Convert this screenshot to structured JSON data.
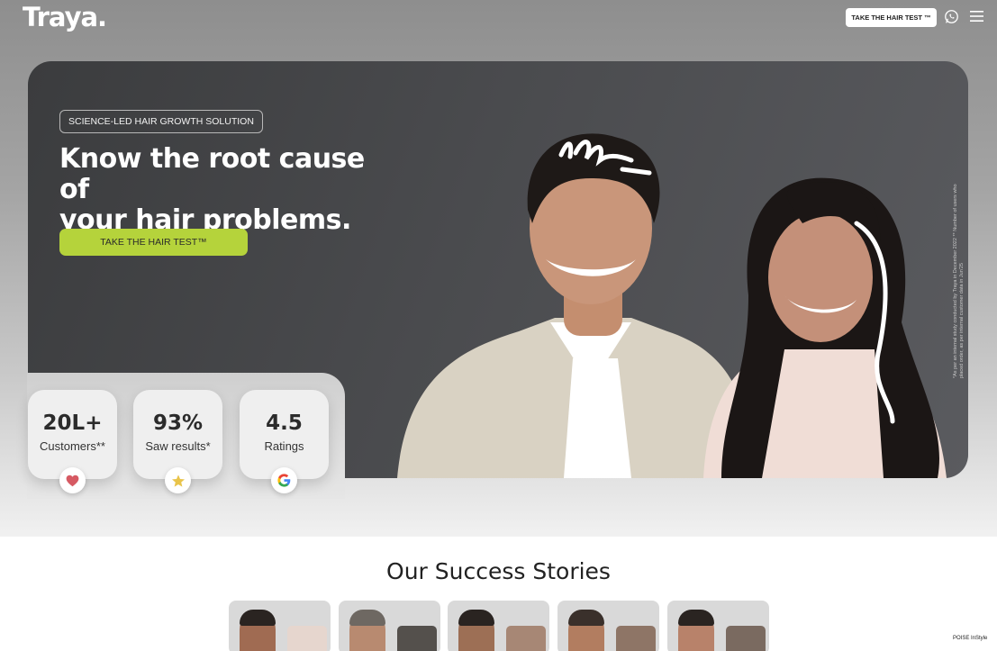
{
  "header": {
    "logo_text": "Traya.",
    "cta_label": "TAKE THE HAIR TEST ™",
    "icons": [
      "whatsapp-icon",
      "hamburger-menu-icon"
    ]
  },
  "hero": {
    "badge": "SCIENCE-LED HAIR GROWTH SOLUTION",
    "headline_line1": "Know the root cause of",
    "headline_line2": "your hair problems.",
    "cta_label": "TAKE THE HAIR TEST™",
    "disclaimer": "*As per an internal study conducted by Traya in December 2022 ** Number of users who placed order, as per internal customer data in Jun'25"
  },
  "stats": [
    {
      "value": "20L+",
      "label": "Customers**",
      "icon": "heart-icon"
    },
    {
      "value": "93%",
      "label": "Saw results*",
      "icon": "star-icon"
    },
    {
      "value": "4.5",
      "label": "Ratings",
      "icon": "google-icon"
    }
  ],
  "success": {
    "title": "Our Success Stories"
  },
  "watermark": "POISE InStyle",
  "colors": {
    "accent_green": "#b5d33b",
    "hero_dark": "#47484b"
  }
}
